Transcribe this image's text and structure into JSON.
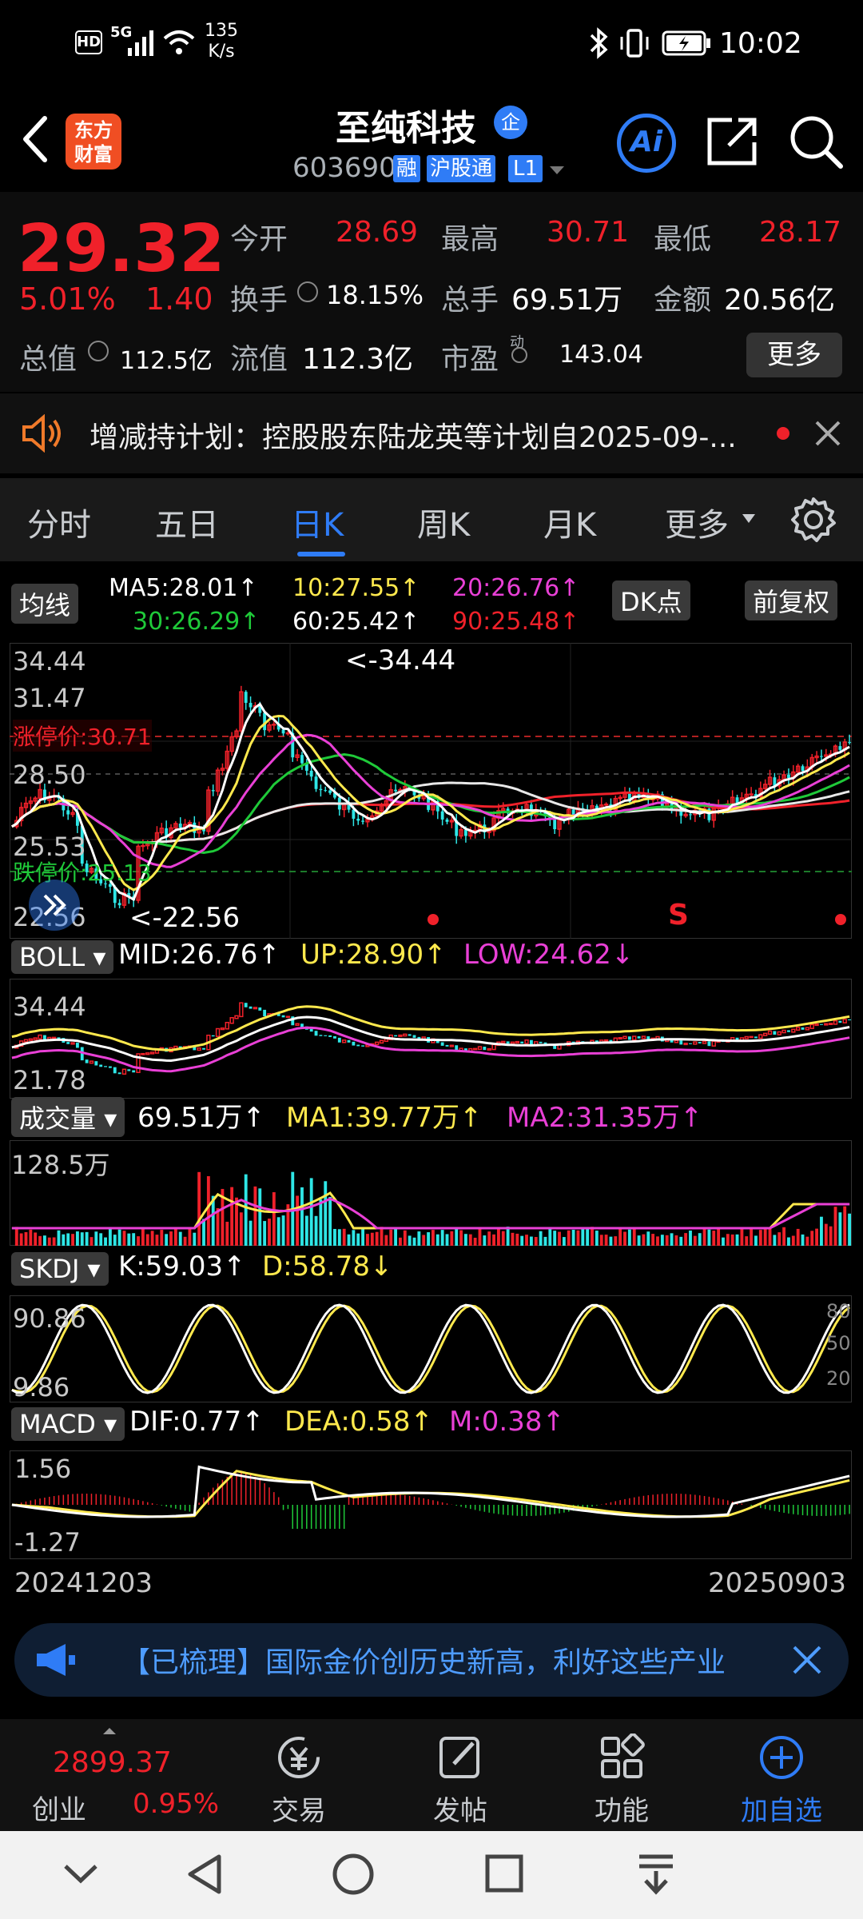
{
  "status_bar": {
    "hd": "HD",
    "net": "5G",
    "speed_val": "135",
    "speed_unit": "K/s",
    "time": "10:02"
  },
  "header": {
    "logo_line1": "东方",
    "logo_line2": "财富",
    "title": "至纯科技",
    "title_badge": "企",
    "code": "603690",
    "tag_rong": "融",
    "tag_hgt": "沪股通",
    "tag_l1": "L1",
    "ai_label": "Ai"
  },
  "quote": {
    "price": "29.32",
    "change_pct": "5.01%",
    "change_abs": "1.40",
    "open_label": "今开",
    "open": "28.69",
    "high_label": "最高",
    "high": "30.71",
    "low_label": "最低",
    "low": "28.17",
    "turnover_label": "换手",
    "turnover": "18.15%",
    "volume_label": "总手",
    "volume": "69.51万",
    "amount_label": "金额",
    "amount": "20.56亿",
    "mktcap_label": "总值",
    "mktcap": "112.5亿",
    "float_label": "流值",
    "float": "112.3亿",
    "pe_label": "市盈",
    "pe_sup": "动",
    "pe": "143.04",
    "more": "更多"
  },
  "notice": {
    "text": "增减持计划：控股股东陆龙英等计划自2025-09-..."
  },
  "tabs": [
    "分时",
    "五日",
    "日K",
    "周K",
    "月K",
    "更多"
  ],
  "active_tab": 2,
  "ma_panel": {
    "pill": "均线",
    "ma5": "MA5:28.01↑",
    "ma10": "10:27.55↑",
    "ma20": "20:26.76↑",
    "ma30": "30:26.29↑",
    "ma60": "60:25.42↑",
    "ma90": "90:25.48↑",
    "dk_pill": "DK点",
    "fq_pill": "前复权",
    "y_top": "34.44",
    "y_2": "31.47",
    "y_3": "28.50",
    "y_4": "25.53",
    "y_bottom": "22.56",
    "limit_up": "涨停价:30.71",
    "limit_down": "跌停价:25.13",
    "high_mark": "<-34.44",
    "low_mark": "<-22.56",
    "s_mark": "S"
  },
  "boll_panel": {
    "pill": "BOLL",
    "mid": "MID:26.76↑",
    "up": "UP:28.90↑",
    "low": "LOW:24.62↓",
    "y_top": "34.44",
    "y_bottom": "21.78"
  },
  "vol_panel": {
    "pill": "成交量",
    "vol": "69.51万↑",
    "ma1": "MA1:39.77万↑",
    "ma2": "MA2:31.35万↑",
    "y_top": "128.5万"
  },
  "skdj_panel": {
    "pill": "SKDJ",
    "k": "K:59.03↑",
    "d": "D:58.78↓",
    "y_top": "90.86",
    "y_bottom": "9.86",
    "r80": "80",
    "r50": "50",
    "r20": "20"
  },
  "macd_panel": {
    "pill": "MACD",
    "dif": "DIF:0.77↑",
    "dea": "DEA:0.58↑",
    "m": "M:0.38↑",
    "y_top": "1.56",
    "y_bottom": "-1.27"
  },
  "x_axis": {
    "start": "20241203",
    "end": "20250903"
  },
  "news": {
    "text": "【已梳理】国际金价创历史新高，利好这些产业"
  },
  "tabbar": {
    "index_value": "2899.37",
    "index_name": "创业",
    "index_pct": "0.95%",
    "items": [
      "交易",
      "发帖",
      "功能",
      "加自选"
    ]
  },
  "colors": {
    "up": "#f0212a",
    "down": "#1fca39",
    "accent": "#2f7cf6",
    "ma5": "#ffffff",
    "ma10": "#ffe94d",
    "ma20": "#e940d6",
    "ma30": "#1fca39",
    "ma60": "#ffffff",
    "ma90": "#f0212a"
  }
}
